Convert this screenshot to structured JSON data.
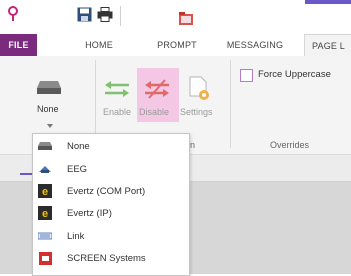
{
  "quick_access": {
    "icons": [
      "pin-icon",
      "save-icon",
      "print-icon",
      "folder-icon"
    ]
  },
  "tabs": [
    {
      "label": "FILE"
    },
    {
      "label": "HOME"
    },
    {
      "label": "PROMPT"
    },
    {
      "label": "MESSAGING"
    },
    {
      "label": "PAGE L"
    }
  ],
  "ribbon": {
    "none_button": {
      "label": "None"
    },
    "enable_button": {
      "label": "Enable"
    },
    "disable_button": {
      "label": "Disable"
    },
    "settings_button": {
      "label": "Settings"
    },
    "group_fragment": "n",
    "force_uppercase": {
      "label": "Force Uppercase",
      "checked": false
    },
    "overrides_group": "Overrides"
  },
  "dropdown": {
    "items": [
      {
        "label": "None",
        "icon": "device-icon"
      },
      {
        "label": "EEG",
        "icon": "eeg-icon"
      },
      {
        "label": "Evertz (COM Port)",
        "icon": "evertz-icon"
      },
      {
        "label": "Evertz (IP)",
        "icon": "evertz-icon"
      },
      {
        "label": "Link",
        "icon": "link-icon"
      },
      {
        "label": "SCREEN Systems",
        "icon": "screen-systems-icon"
      }
    ]
  },
  "colors": {
    "file_tab": "#7a2b7d",
    "accent_bar": "#6b58c8",
    "disable_highlight": "#f4c8e4"
  }
}
